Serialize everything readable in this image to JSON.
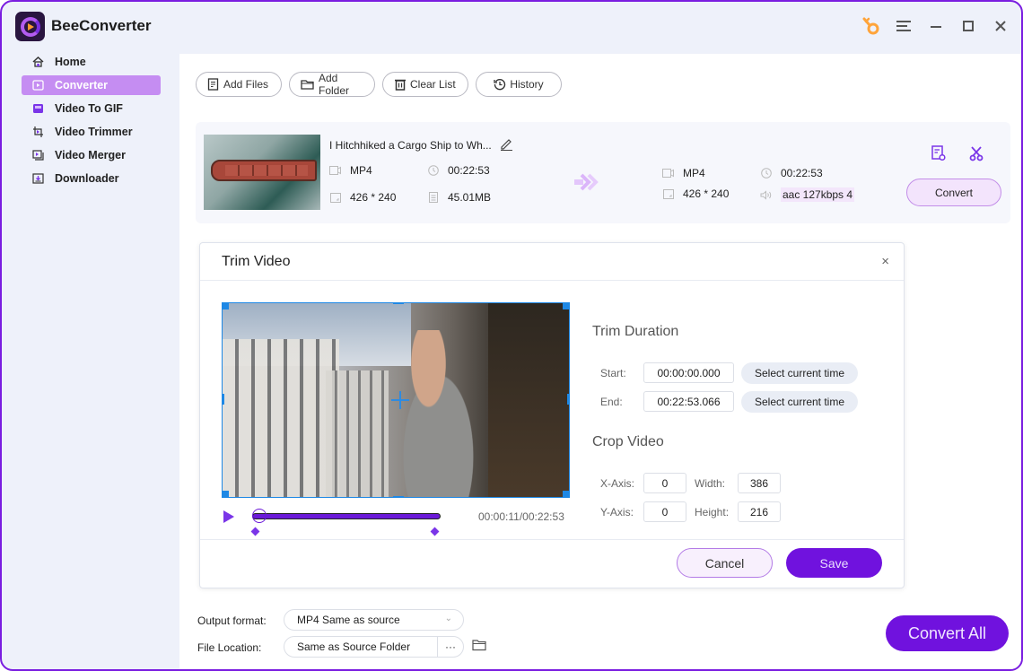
{
  "app": {
    "title": "BeeConverter",
    "accent_color": "#7012de",
    "window_controls": [
      {
        "name": "key-icon",
        "glyph": "key"
      },
      {
        "name": "menu-icon",
        "glyph": "☰"
      },
      {
        "name": "minimize-icon",
        "glyph": "—"
      },
      {
        "name": "maximize-icon",
        "glyph": "☐"
      },
      {
        "name": "close-icon",
        "glyph": "✕"
      }
    ]
  },
  "sidebar": {
    "items": [
      {
        "label": "Home",
        "icon": "home-icon",
        "active": false
      },
      {
        "label": "Converter",
        "icon": "converter-icon",
        "active": true
      },
      {
        "label": "Video To GIF",
        "icon": "gif-icon",
        "active": false
      },
      {
        "label": "Video Trimmer",
        "icon": "trimmer-icon",
        "active": false
      },
      {
        "label": "Video Merger",
        "icon": "merger-icon",
        "active": false
      },
      {
        "label": "Downloader",
        "icon": "download-icon",
        "active": false
      }
    ]
  },
  "toolbar": {
    "add_files": "Add Files",
    "add_folder": "Add Folder",
    "clear_list": "Clear List",
    "history": "History"
  },
  "file": {
    "name": "I Hitchhiked a Cargo Ship to Wh...",
    "source": {
      "format": "MP4",
      "duration": "00:22:53",
      "resolution": "426 * 240",
      "size": "45.01MB"
    },
    "output": {
      "format": "MP4",
      "duration": "00:22:53",
      "resolution": "426 * 240",
      "audio": "aac 127kbps 4"
    },
    "convert_label": "Convert"
  },
  "trim_dialog": {
    "title": "Trim Video",
    "close_glyph": "×",
    "trim_duration_title": "Trim Duration",
    "start_label": "Start:",
    "start_value": "00:00:00.000",
    "end_label": "End:",
    "end_value": "00:22:53.066",
    "select_current_time": "Select current time",
    "crop_title": "Crop Video",
    "x_axis_label": "X-Axis:",
    "x_axis_value": "0",
    "y_axis_label": "Y-Axis:",
    "y_axis_value": "0",
    "width_label": "Width:",
    "width_value": "386",
    "height_label": "Height:",
    "height_value": "216",
    "playback_time": "00:00:11/00:22:53",
    "playback_progress": 0.008,
    "trim_start_fraction": 0.0,
    "trim_end_fraction": 1.0,
    "cancel_label": "Cancel",
    "save_label": "Save"
  },
  "bottom": {
    "output_format_label": "Output format:",
    "output_format_value": "MP4 Same as source",
    "file_location_label": "File Location:",
    "file_location_value": "Same as Source Folder",
    "browse_glyph": "···",
    "convert_all_label": "Convert All"
  }
}
